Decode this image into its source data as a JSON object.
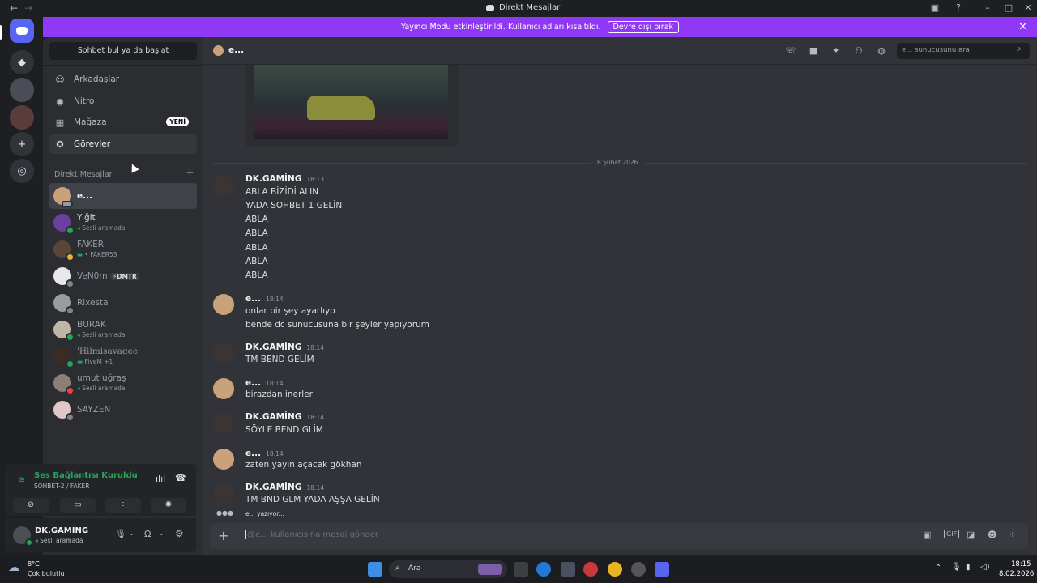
{
  "window": {
    "title": "Direkt Mesajlar",
    "back": "←",
    "forward": "→"
  },
  "banner": {
    "text": "Yayıncı Modu etkinleştirildi. Kullanıcı adları kısaltıldı.",
    "button": "Devre dışı bırak",
    "close": "✕"
  },
  "sidebar": {
    "search": "Sohbet bul ya da başlat",
    "nav": [
      {
        "label": "Arkadaşlar",
        "icon": "friends-icon"
      },
      {
        "label": "Nitro",
        "icon": "nitro-icon"
      },
      {
        "label": "Mağaza",
        "icon": "shop-icon",
        "badge": "YENİ"
      },
      {
        "label": "Görevler",
        "icon": "quests-icon"
      }
    ],
    "dm_header": "Direkt Mesajlar",
    "dm_plus": "+",
    "dms": [
      {
        "name": "e...",
        "sub": ""
      },
      {
        "name": "Yiğit",
        "sub": "Sesli aramada"
      },
      {
        "name": "FAKER",
        "sub": "• FAKER53"
      },
      {
        "name": "VeN0m",
        "sub": "",
        "tag": "DMTR"
      },
      {
        "name": "Rixesta",
        "sub": ""
      },
      {
        "name": "BURAK",
        "sub": "Sesli aramada"
      },
      {
        "name": "'Hilmisavagee",
        "sub": "FiveM +1"
      },
      {
        "name": "umut uğraş",
        "sub": "Sesli aramada"
      },
      {
        "name": "SAYZEN",
        "sub": ""
      }
    ]
  },
  "voice": {
    "status": "Ses Bağlantısı Kuruldu",
    "channel": "SOHBET-2 / FAKER"
  },
  "user": {
    "name": "DK.GAMİNG",
    "status": "Sesli aramada"
  },
  "chat": {
    "header_name": "e...",
    "search_placeholder": "e... sunucusunu ara",
    "date_divider": "8 Şubat 2026",
    "messages": [
      {
        "author": "DK.GAMİNG",
        "time": "18:13",
        "lines": [
          "ABLA BİZİDİ ALIN",
          "YADA SOHBET 1 GELİN",
          "ABLA",
          "ABLA",
          "ABLA",
          "ABLA",
          "ABLA"
        ]
      },
      {
        "author": "e...",
        "time": "18:14",
        "lines": [
          "onlar bir şey ayarlıyo",
          "bende dc sunucusuna bir şeyler yapıyorum"
        ]
      },
      {
        "author": "DK.GAMİNG",
        "time": "18:14",
        "lines": [
          "TM BEND GELİM"
        ]
      },
      {
        "author": "e...",
        "time": "18:14",
        "lines": [
          "birazdan inerler"
        ]
      },
      {
        "author": "DK.GAMİNG",
        "time": "18:14",
        "lines": [
          "SÖYLE BEND GLİM"
        ]
      },
      {
        "author": "e...",
        "time": "18:14",
        "lines": [
          "zaten yayın açacak gökhan"
        ]
      },
      {
        "author": "DK.GAMİNG",
        "time": "18:14",
        "lines": [
          "TM BND GLM YADA AŞŞA GELİN"
        ]
      }
    ],
    "typing": "e... yazıyor...",
    "composer_placeholder": "@e... kullanıcısına mesaj gönder"
  },
  "taskbar": {
    "weather_temp": "8°C",
    "weather_desc": "Çok bulutlu",
    "search": "Ara",
    "time": "18:15",
    "date": "8.02.2026"
  },
  "colors": {
    "banner": "#8f39f6",
    "online": "#23a55a",
    "blurple": "#5865f2"
  }
}
